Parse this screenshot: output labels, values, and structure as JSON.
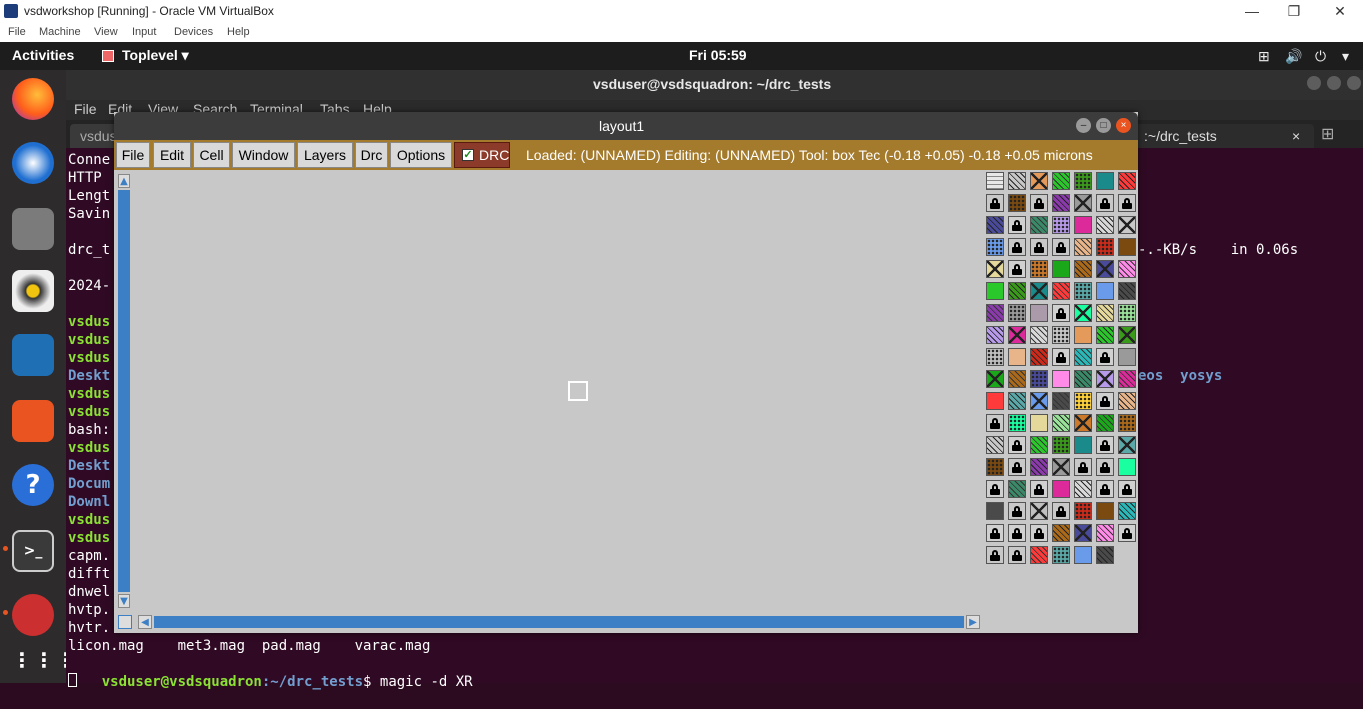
{
  "vbox": {
    "title": "vsdworkshop [Running] - Oracle VM VirtualBox",
    "menu": [
      "File",
      "Machine",
      "View",
      "Input",
      "Devices",
      "Help"
    ],
    "controls": [
      "—",
      "❐",
      "✕"
    ]
  },
  "topbar": {
    "activities": "Activities",
    "app": "Toplevel ▾",
    "clock": "Fri 05:59",
    "tray": [
      "⊞",
      "🔊",
      "⏻",
      "▾"
    ]
  },
  "terminal": {
    "title": "vsduser@vsdsquadron: ~/drc_tests",
    "menu": [
      "File",
      "Edit",
      "View",
      "Search",
      "Terminal",
      "Tabs",
      "Help"
    ],
    "tabs": [
      {
        "label": "vsdus"
      },
      {
        "label": ":~/drc_tests",
        "close": "×"
      }
    ],
    "lines": [
      {
        "text": "Conne",
        "cls": ""
      },
      {
        "text": "HTTP ",
        "cls": ""
      },
      {
        "text": "Lengt",
        "cls": ""
      },
      {
        "text": "Savin",
        "cls": ""
      },
      {
        "text": "",
        "cls": ""
      },
      {
        "text": "drc_t",
        "cls": ""
      },
      {
        "text": "",
        "cls": ""
      },
      {
        "text": "2024-",
        "cls": ""
      },
      {
        "text": "",
        "cls": ""
      },
      {
        "text": "vsdus",
        "cls": "green"
      },
      {
        "text": "vsdus",
        "cls": "green"
      },
      {
        "text": "vsdus",
        "cls": "green"
      },
      {
        "text": "Deskt",
        "cls": "blue"
      },
      {
        "text": "vsdus",
        "cls": "green"
      },
      {
        "text": "vsdus",
        "cls": "green"
      },
      {
        "text": "bash:",
        "cls": ""
      },
      {
        "text": "vsdus",
        "cls": "green"
      },
      {
        "text": "Deskt",
        "cls": "blue"
      },
      {
        "text": "Docum",
        "cls": "blue"
      },
      {
        "text": "Downl",
        "cls": "blue"
      },
      {
        "text": "vsdus",
        "cls": "green"
      },
      {
        "text": "vsdus",
        "cls": "green"
      },
      {
        "text": "capm.",
        "cls": ""
      },
      {
        "text": "difft",
        "cls": ""
      },
      {
        "text": "dnwel",
        "cls": ""
      },
      {
        "text": "hvtp.",
        "cls": ""
      },
      {
        "text": "hvtr.",
        "cls": ""
      },
      {
        "text": "licon.mag    met3.mag  pad.mag    varac.mag",
        "cls": ""
      }
    ],
    "right_text": {
      "speed": "-.-KB/s    in 0.06s",
      "dirs": "eos  yosys"
    },
    "prompt_user": "vsduser@vsdsquadron",
    "prompt_path": ":~/drc_tests",
    "prompt_cmd": "$ magic -d XR"
  },
  "layout": {
    "title": "layout1",
    "menu": [
      "File",
      "Edit",
      "Cell",
      "Window",
      "Layers",
      "Drc",
      "Options"
    ],
    "drc_label": "DRC",
    "drc_checked": "✓",
    "status": "Loaded: (UNNAMED) Editing: (UNNAMED) Tool: box  Tec     (-0.18 +0.05) -0.18 +0.05 microns",
    "up_arrow": "▲",
    "down_arrow": "▼",
    "left_arrow": "◀",
    "right_arrow": "▶",
    "win_buttons": [
      "–",
      "□",
      "×"
    ]
  }
}
